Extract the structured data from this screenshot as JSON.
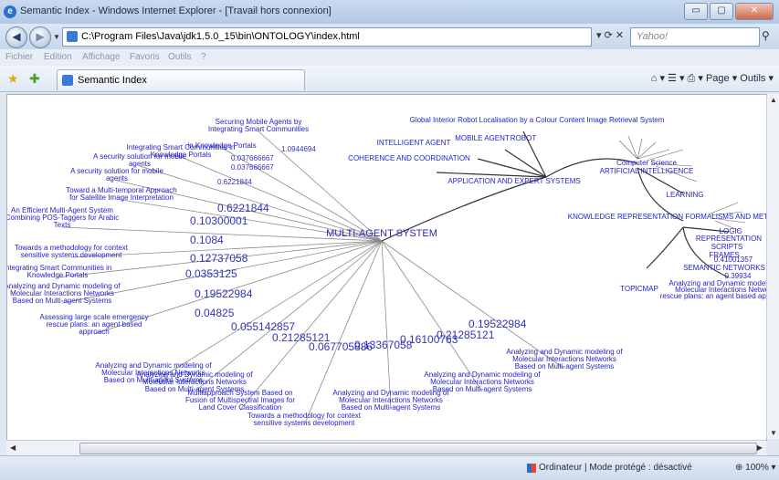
{
  "window": {
    "title": "Semantic Index - Windows Internet Explorer - [Travail hors connexion]",
    "min": "▭",
    "max": "▢",
    "close": "✕"
  },
  "addressbar": {
    "url": "C:\\Program Files\\Java\\jdk1.5.0_15\\bin\\ONTOLOGY\\index.html",
    "search_placeholder": "Yahoo!"
  },
  "menu": [
    "Fichier",
    "Edition",
    "Affichage",
    "Favoris",
    "Outils",
    "?"
  ],
  "tab": {
    "label": "Semantic Index"
  },
  "commands": "Page ▾  Outils ▾",
  "status": {
    "text": "Ordinateur | Mode protégé : désactivé",
    "zoom": "100%"
  },
  "graph": {
    "center": "MULTI-AGENT SYSTEM",
    "leaves": [
      {
        "text": "Securing Mobile Agents by Integrating Smart Communities"
      },
      {
        "text": "in Knowledge Portals"
      },
      {
        "text": "Integrating Smart Communities in Knowledge Portals"
      },
      {
        "text": "A security solution for mobile agents"
      },
      {
        "text": "A security solution for mobile agents"
      },
      {
        "text": "Toward a Multi-temporal Approach for Satellite Image Interpretation"
      },
      {
        "text": "An Efficient Multi-Agent System Combining POS-Taggers for Arabic Texts"
      },
      {
        "text": "Towards a methodology for context sensitive systems development"
      },
      {
        "text": "Integrating Smart Communities in Knowledge Portals"
      },
      {
        "text": "Analyzing and Dynamic modeling of Molecular Interactions Networks Based on Multi-agent Systems"
      },
      {
        "text": "Assessing large scale emergency rescue plans: an agent based approach"
      },
      {
        "text": "Analyzing and Dynamic modeling of Molecular Interactions Networks Based on Multi-agent Systems"
      },
      {
        "text": "Analyzing and Dynamic modeling of Molecular Interactions Networks Based on Multi-agent Systems"
      },
      {
        "text": "Multiapproach System Based on Fusion of Multispectral Images for Land Cover Classification"
      },
      {
        "text": "Towards a methodology for context sensitive systems development"
      },
      {
        "text": "Analyzing and Dynamic modeling of Molecular Interactions Networks Based on Multi-agent Systems"
      },
      {
        "text": "Analyzing and Dynamic modeling of Molecular Interactions Networks Based on Multi-agent Systems"
      },
      {
        "text": "Analyzing and Dynamic modeling of Molecular Interactions Networks Based on Multi-agent Systems"
      }
    ],
    "weights": [
      "1.0944694",
      "0.037666667",
      "0.037666667",
      "0.6221844",
      "0.6221844",
      "0.10300001",
      "0.1084",
      "0.12737058",
      "0.0353125",
      "0.19522984",
      "0.04825",
      "0.055142857",
      "0.21285121",
      "0.067705886",
      "0.13367058",
      "0.16100763",
      "0.21285121",
      "0.19522984"
    ],
    "right_nodes": {
      "intelligent_agent": "INTELLIGENT AGENT",
      "mobile_agent": "MOBILE AGENT",
      "robot": "ROBOT",
      "global": "Global Interior Robot Localisation by a Colour Content Image Retrieval System",
      "coherence": "COHERENCE AND COORDINATION",
      "application": "APPLICATION AND EXPERT SYSTEMS",
      "cs": "Computer Science",
      "ai": "ARTIFICIAL INTELLIGENCE",
      "learning": "LEARNING",
      "krfm": "KNOWLEDGE REPRESENTATION FORMALISMS AND METHODS",
      "logic": "LOGIC",
      "representation": "REPRESENTATION",
      "scripts": "SCRIPTS",
      "frames": "FRAMES",
      "semantic": "SEMANTIC NETWORKS",
      "topicmap": "TOPICMAP",
      "val1": "0.41001357",
      "val2": "0.39934",
      "rescue": "rescue plans: an agent based approach",
      "ana1": "Analyzing and Dynamic modeling of",
      "ana2": "Molecular Interactions Networks"
    }
  }
}
